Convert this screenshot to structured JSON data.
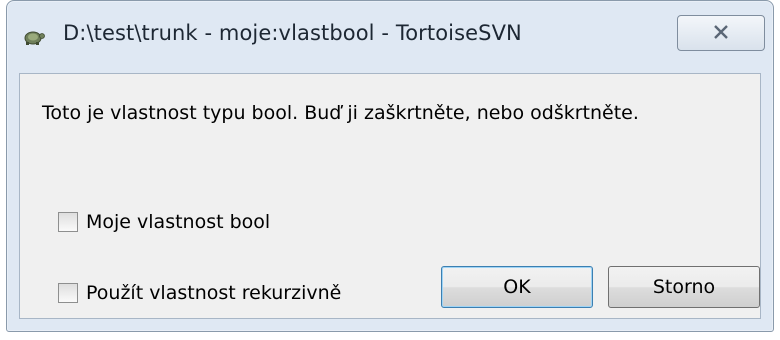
{
  "window": {
    "title": "D:\\test\\trunk - moje:vlastbool - TortoiseSVN",
    "close_label": "X"
  },
  "dialog": {
    "message": "Toto je vlastnost typu bool. Buď ji zaškrtněte, nebo odškrtněte.",
    "property_checkbox": {
      "label": "Moje vlastnost bool",
      "checked": false
    },
    "recursive_checkbox": {
      "label": "Použít vlastnost rekurzivně",
      "checked": false
    },
    "ok_label": "OK",
    "cancel_label": "Storno"
  },
  "icons": {
    "app": "tortoise-icon",
    "close": "close-icon"
  }
}
